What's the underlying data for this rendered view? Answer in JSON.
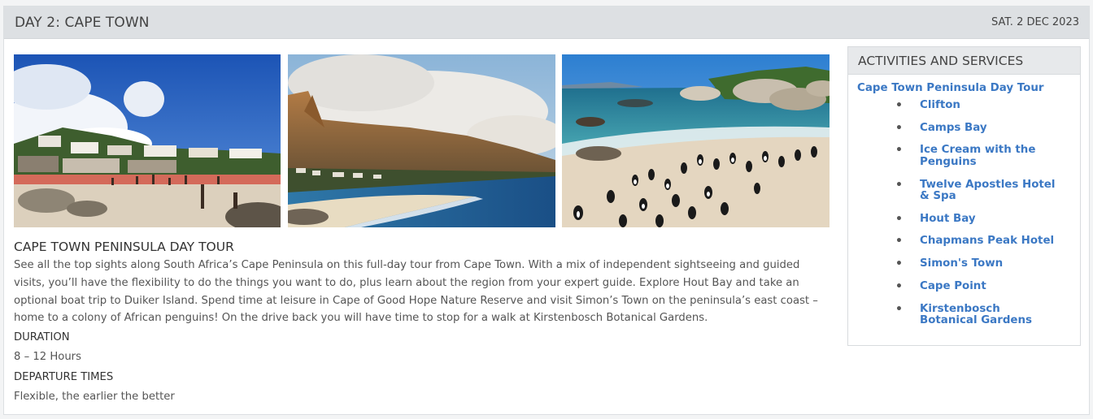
{
  "header": {
    "title": "DAY 2:  CAPE TOWN",
    "date": "SAT. 2 DEC 2023"
  },
  "photos": [
    {
      "subject": "clifton-beach-photo"
    },
    {
      "subject": "camps-bay-twelve-apostles-photo"
    },
    {
      "subject": "boulders-beach-penguins-photo"
    }
  ],
  "tour": {
    "title": "CAPE TOWN PENINSULA DAY TOUR",
    "description": "See all the top sights along South Africa’s Cape Peninsula on this full-day tour from Cape Town. With a mix of independent sightseeing and guided visits, you’ll have the flexibility to do the things you want to do, plus learn about the region from your expert guide. Explore Hout Bay and take an optional boat trip to Duiker Island. Spend time at leisure in Cape of Good Hope Nature Reserve and visit Simon’s Town on the peninsula’s east coast – home to a colony of African penguins! On the drive back you will have time to stop for a walk at Kirstenbosch Botanical Gardens.",
    "duration_label": "DURATION",
    "duration_value": "8 – 12 Hours",
    "departure_label": "DEPARTURE TIMES",
    "departure_value": "Flexible, the earlier the better"
  },
  "sidebar": {
    "title": "ACTIVITIES AND SERVICES",
    "tour_link": "Cape Town Peninsula Day Tour",
    "items": [
      {
        "label": "Clifton"
      },
      {
        "label": "Camps Bay"
      },
      {
        "label": "Ice Cream with the Penguins"
      },
      {
        "label": "Twelve Apostles Hotel & Spa"
      },
      {
        "label": "Hout Bay"
      },
      {
        "label": "Chapmans Peak Hotel"
      },
      {
        "label": "Simon's Town"
      },
      {
        "label": "Cape Point"
      },
      {
        "label": "Kirstenbosch Botanical Gardens"
      }
    ]
  },
  "colors": {
    "link": "#3b78c4",
    "header_bg": "#dde0e3"
  }
}
